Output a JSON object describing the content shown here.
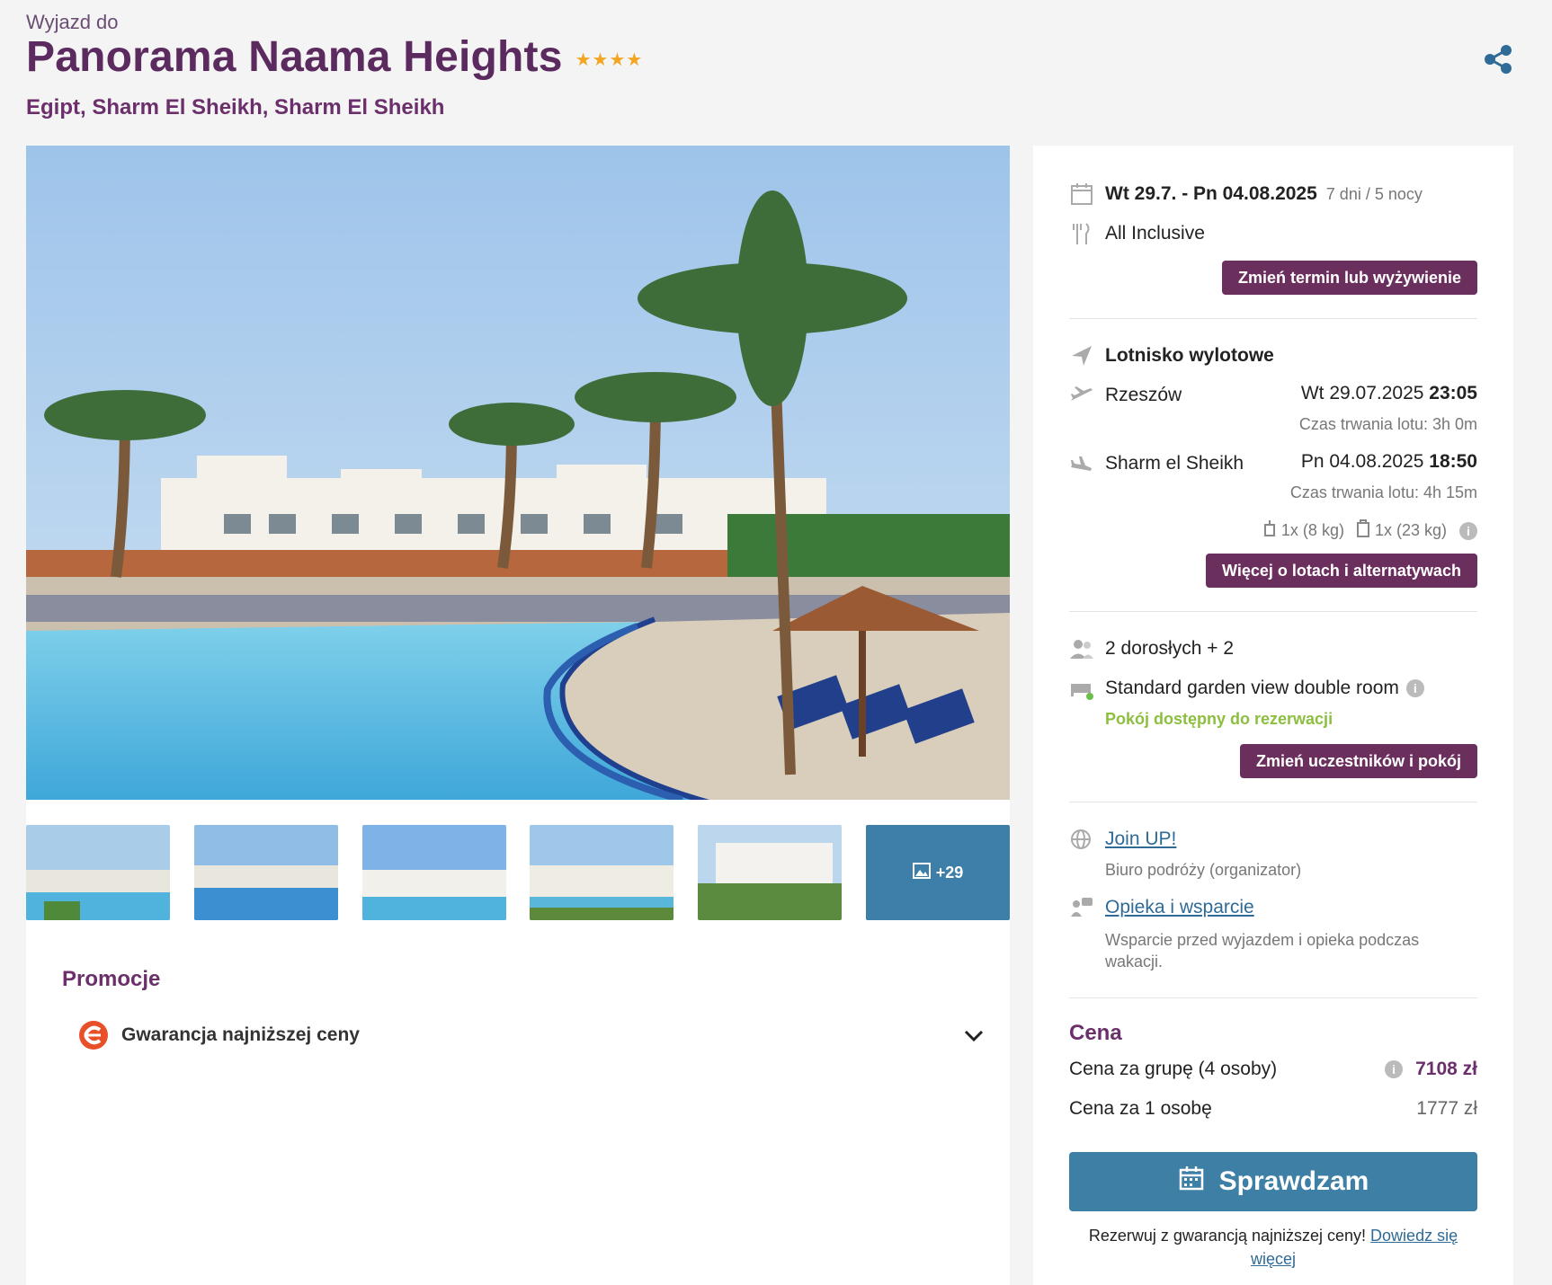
{
  "header": {
    "subtitle": "Wyjazd do",
    "title": "Panorama Naama Heights",
    "stars": "★★★★",
    "location": "Egipt, Sharm El Sheikh, Sharm El Sheikh"
  },
  "gallery": {
    "more_count": "+29"
  },
  "promo": {
    "title": "Promocje",
    "item": "Gwarancja najniższej ceny"
  },
  "booking": {
    "dates": "Wt 29.7. - Pn 04.08.2025",
    "duration": "7 dni / 5 nocy",
    "board": "All Inclusive",
    "change_date_btn": "Zmień termin lub wyżywienie",
    "airport_label": "Lotnisko wylotowe",
    "outbound": {
      "city": "Rzeszów",
      "date": "Wt 29.07.2025",
      "time": "23:05",
      "duration": "Czas trwania lotu: 3h 0m"
    },
    "inbound": {
      "city": "Sharm el Sheikh",
      "date": "Pn 04.08.2025",
      "time": "18:50",
      "duration": "Czas trwania lotu: 4h 15m"
    },
    "luggage_hand": "1x (8 kg)",
    "luggage_checked": "1x (23 kg)",
    "flights_btn": "Więcej o lotach i alternatywach",
    "persons": "2 dorosłych + 2",
    "room": "Standard garden view double room",
    "room_status": "Pokój dostępny do rezerwacji",
    "change_room_btn": "Zmień uczestników i pokój",
    "organizer_link": "Join UP!",
    "organizer_desc": "Biuro podróży (organizator)",
    "support_link": "Opieka i wsparcie",
    "support_desc": "Wsparcie przed wyjazdem i opieka podczas wakacji."
  },
  "price": {
    "title": "Cena",
    "group_label": "Cena za grupę (4 osoby)",
    "group_value": "7108 zł",
    "person_label": "Cena za 1 osobę",
    "person_value": "1777 zł",
    "cta": "Sprawdzam",
    "note_text": "Rezerwuj z gwarancją najniższej ceny!",
    "note_link": "Dowiedz się więcej"
  }
}
